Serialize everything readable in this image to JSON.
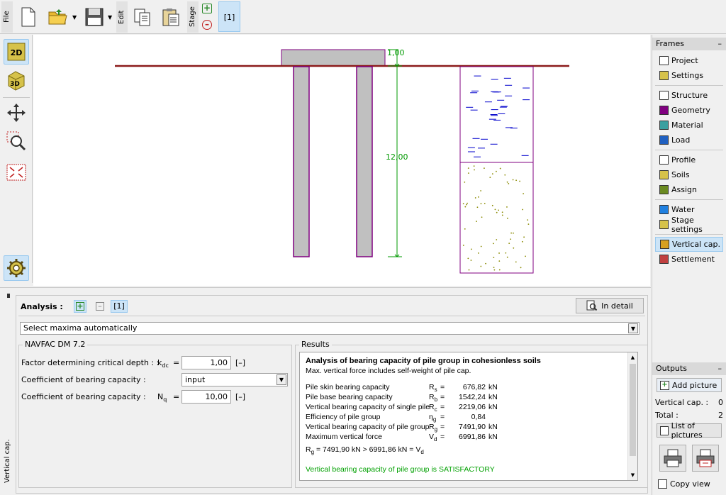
{
  "toolbar": {
    "file_label": "File",
    "edit_label": "Edit",
    "stage_label": "Stage",
    "stage_number": "[1]"
  },
  "drawing": {
    "dim_top": "1,00",
    "dim_pile": "12,00"
  },
  "frames": {
    "title": "Frames",
    "collapse": "–",
    "items": [
      {
        "label": "Project",
        "icon": "project-icon"
      },
      {
        "label": "Settings",
        "icon": "settings-icon"
      },
      {
        "label": "Structure",
        "icon": "structure-icon"
      },
      {
        "label": "Geometry",
        "icon": "geometry-icon"
      },
      {
        "label": "Material",
        "icon": "material-icon"
      },
      {
        "label": "Load",
        "icon": "load-icon"
      },
      {
        "label": "Profile",
        "icon": "profile-icon"
      },
      {
        "label": "Soils",
        "icon": "soils-icon"
      },
      {
        "label": "Assign",
        "icon": "assign-icon"
      },
      {
        "label": "Water",
        "icon": "water-icon"
      },
      {
        "label": "Stage settings",
        "icon": "stage-settings-icon"
      },
      {
        "label": "Vertical cap.",
        "icon": "vertical-cap-icon"
      },
      {
        "label": "Settlement",
        "icon": "settlement-icon"
      }
    ]
  },
  "outputs": {
    "title": "Outputs",
    "collapse": "–",
    "add_picture": "Add picture",
    "vertical_cap_label": "Vertical cap. :",
    "vertical_cap_value": "0",
    "total_label": "Total :",
    "total_value": "2",
    "list_of_pictures": "List of pictures",
    "copy_view": "Copy view"
  },
  "analysis": {
    "side_tab": "Vertical cap.",
    "label": "Analysis :",
    "index": "[1]",
    "in_detail": "In detail",
    "select_mode": "Select maxima automatically",
    "navfac_group": "NAVFAC DM 7.2",
    "results_group": "Results",
    "params": [
      {
        "label": "Factor determining critical depth : :",
        "symbol": "k",
        "sub": "dc",
        "value": "1,00",
        "unit": "[–]"
      },
      {
        "label": "Coefficient of bearing capacity :",
        "symbol": "",
        "sub": "",
        "value": "input",
        "unit": ""
      },
      {
        "label": "Coefficient of bearing capacity :",
        "symbol": "N",
        "sub": "q",
        "value": "10,00",
        "unit": "[–]"
      }
    ]
  },
  "results": {
    "title": "Analysis of bearing capacity of pile group in cohesionless soils",
    "note": "Max. vertical force includes self-weight of pile cap.",
    "rows": [
      {
        "label": "Pile skin bearing capacity",
        "sym": "R",
        "sub": "s",
        "eq": "=",
        "val": "676,82",
        "unit": "kN"
      },
      {
        "label": "Pile base bearing capacity",
        "sym": "R",
        "sub": "b",
        "eq": "=",
        "val": "1542,24",
        "unit": "kN"
      },
      {
        "label": "Vertical bearing capacity of single pile",
        "sym": "R",
        "sub": "c",
        "eq": "=",
        "val": "2219,06",
        "unit": "kN"
      },
      {
        "label": "Efficiency of pile group",
        "sym": "η",
        "sub": "g",
        "eq": "=",
        "val": "0,84",
        "unit": ""
      },
      {
        "label": "Vertical bearing capacity of pile group",
        "sym": "R",
        "sub": "g",
        "eq": "=",
        "val": "7491,90",
        "unit": "kN"
      },
      {
        "label": "Maximum vertical force",
        "sym": "V",
        "sub": "d",
        "eq": "=",
        "val": "6991,86",
        "unit": "kN"
      }
    ],
    "check_pre": "R",
    "check_sub1": "g",
    "check_mid": " = 7491,90 kN > 6991,86 kN = V",
    "check_sub2": "d",
    "verdict": "Vertical bearing capacity of pile group is SATISFACTORY"
  },
  "colors": {
    "ground_line": "#8b1a1a",
    "pile_fill": "#c0c0c0",
    "pile_border": "#800080",
    "dimension": "#009900",
    "satisfactory": "#00a000",
    "water": "#0000cc",
    "sand_dot": "#8a8a00"
  }
}
